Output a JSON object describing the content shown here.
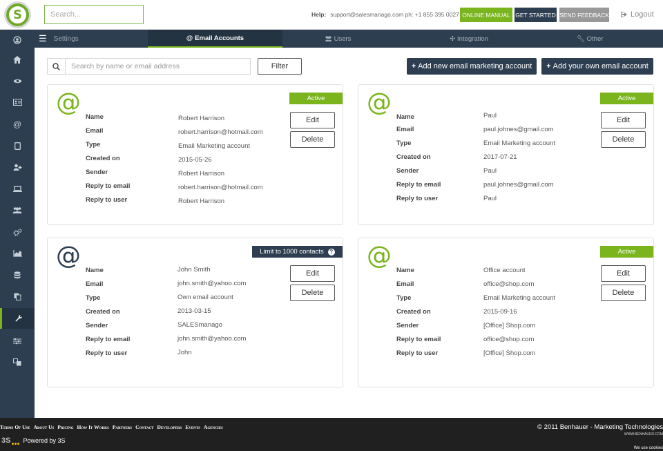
{
  "header": {
    "search_placeholder": "Search...",
    "help_label": "Help:",
    "help_text": "support@salesmanago.com ph: +1 855 395 0027",
    "online_manual": "ONLINE MANUAL",
    "get_started": "GET STARTED",
    "send_feedback": "SEND FEEDBACK",
    "logout": "Logout"
  },
  "nav": {
    "settings": "Settings",
    "tabs": [
      {
        "label": "Email Accounts",
        "icon": "at-icon"
      },
      {
        "label": "Users",
        "icon": "users-icon"
      },
      {
        "label": "Integration",
        "icon": "puzzle-icon"
      },
      {
        "label": "Other",
        "icon": "wrench-icon"
      }
    ]
  },
  "sidebar": {
    "items": [
      "user-circle-icon",
      "home-icon",
      "eye-icon",
      "contact-card-icon",
      "at-icon",
      "tablet-icon",
      "add-user-icon",
      "laptop-icon",
      "users-icon",
      "cogs-icon",
      "area-chart-icon",
      "database-icon",
      "copy-icon",
      "wrench-icon",
      "sliders-icon",
      "language-icon"
    ],
    "active_index": 13
  },
  "toolbar": {
    "search_placeholder": "Search by name or email address",
    "filter": "Filter",
    "add_marketing": "Add new email marketing account",
    "add_own": "Add your own email account"
  },
  "field_labels": {
    "name": "Name",
    "email": "Email",
    "type": "Type",
    "created_on": "Created on",
    "sender": "Sender",
    "reply_to_email": "Reply to email",
    "reply_to_user": "Reply to user"
  },
  "buttons": {
    "edit": "Edit",
    "delete": "Delete"
  },
  "accounts": [
    {
      "status": "Active",
      "name": "Robert Harrison",
      "email": "robert.harrison@hotmail.com",
      "type": "Email Marketing account",
      "created_on": "2015-05-26",
      "sender": "Robert Harrison",
      "reply_to_email": "robert.harrison@hotmail.com",
      "reply_to_user": "Robert Harrison"
    },
    {
      "status": "Active",
      "name": "Paul",
      "email": "paul.johnes@gmail.com",
      "type": "Email Marketing account",
      "created_on": "2017-07-21",
      "sender": "Paul",
      "reply_to_email": "paul.johnes@gmail.com",
      "reply_to_user": "Paul"
    },
    {
      "status": "Limit to 1000 contacts",
      "name": "John Smith",
      "email": "john.smith@yahoo.com",
      "type": "Own email account",
      "created_on": "2013-03-15",
      "sender": "SALESmanago",
      "reply_to_email": "john.smith@yahoo.com",
      "reply_to_user": "John"
    },
    {
      "status": "Active",
      "name": "Office account",
      "email": "office@shop.com",
      "type": "Email Marketing account",
      "created_on": "2015-09-16",
      "sender": "[Office] Shop.com",
      "reply_to_email": "office@shop.com",
      "reply_to_user": "[Office] Shop.com"
    }
  ],
  "footer": {
    "links": [
      "Terms Of Use",
      "About Us",
      "Pricing",
      "How It Works",
      "Partners",
      "Contact",
      "Developers",
      "Events",
      "Agencies"
    ],
    "copyright": "© 2011 Benhauer - Marketing Technologies",
    "website": "WWW.BENHAUER.COM",
    "powered_by": "Powered by 3S",
    "powered_logo": "3S",
    "cookies": "We use cookies"
  },
  "colors": {
    "brand_green": "#7ab51d",
    "navy": "#2d3e50",
    "footer": "#202020"
  }
}
